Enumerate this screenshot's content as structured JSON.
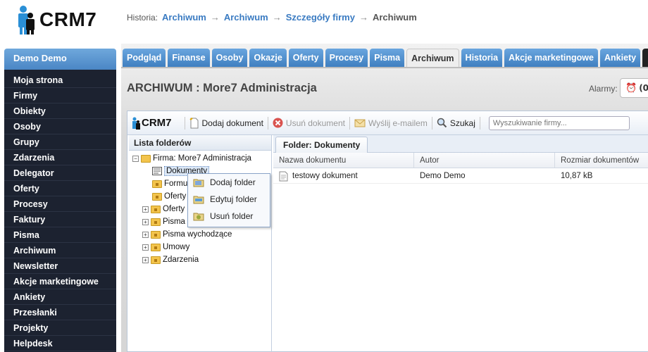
{
  "app": {
    "logo_text": "CRM7"
  },
  "breadcrumb": {
    "label": "Historia:",
    "items": [
      "Archiwum",
      "Archiwum",
      "Szczegóły firmy"
    ],
    "current": "Archiwum",
    "separator": "→"
  },
  "sidebar": {
    "user": "Demo Demo",
    "items": [
      "Moja strona",
      "Firmy",
      "Obiekty",
      "Osoby",
      "Grupy",
      "Zdarzenia",
      "Delegator",
      "Oferty",
      "Procesy",
      "Faktury",
      "Pisma",
      "Archiwum",
      "Newsletter",
      "Akcje marketingowe",
      "Ankiety",
      "Przesłanki",
      "Projekty",
      "Helpdesk"
    ]
  },
  "tabs": {
    "items": [
      "Podgląd",
      "Finanse",
      "Osoby",
      "Okazje",
      "Oferty",
      "Procesy",
      "Pisma",
      "Archiwum",
      "Historia",
      "Akcje marketingowe",
      "Ankiety"
    ],
    "active": "Archiwum",
    "more_icon": "▼"
  },
  "page": {
    "title": "ARCHIWUM : More7 Administracja"
  },
  "alarms": {
    "label": "Alarmy:",
    "value": "(0"
  },
  "toolbar": {
    "logo_text": "CRM7",
    "add_document": "Dodaj dokument",
    "delete_document": "Usuń dokument",
    "send_email": "Wyślij e-mailem",
    "search": "Szukaj",
    "search_placeholder": "Wyszukiwanie firmy..."
  },
  "folder_list": {
    "header": "Lista folderów",
    "root": "Firma: More7 Administracja",
    "items": [
      {
        "label": "Dokumenty",
        "selected": true
      },
      {
        "label": "Formul"
      },
      {
        "label": "Oferty"
      },
      {
        "label": "Oferty"
      },
      {
        "label": "Pisma"
      },
      {
        "label": "Pisma wychodzące"
      },
      {
        "label": "Umowy"
      },
      {
        "label": "Zdarzenia"
      }
    ]
  },
  "context_menu": {
    "items": [
      "Dodaj folder",
      "Edytuj folder",
      "Usuń folder"
    ]
  },
  "documents": {
    "tab": "Folder: Dokumenty",
    "columns": [
      "Nazwa dokumentu",
      "Autor",
      "Rozmiar dokumentów"
    ],
    "rows": [
      {
        "name": "testowy dokument",
        "author": "Demo Demo",
        "size": "10,87 kB"
      }
    ]
  },
  "colors": {
    "accent_blue": "#4a86c5",
    "sidebar_bg": "#1c2230",
    "link": "#3a7bc2"
  }
}
